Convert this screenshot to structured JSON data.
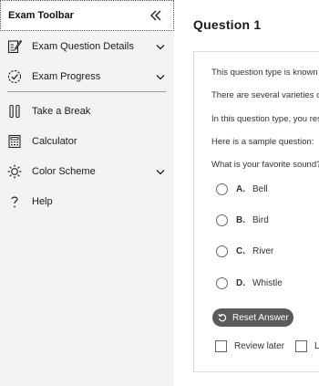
{
  "sidebar": {
    "title": "Exam Toolbar",
    "items": [
      {
        "label": "Exam Question Details",
        "icon": "edit-document-icon",
        "has_chevron": true
      },
      {
        "label": "Exam Progress",
        "icon": "checklist-icon",
        "has_chevron": true
      },
      {
        "label": "Take a Break",
        "icon": "pause-icon",
        "has_chevron": false
      },
      {
        "label": "Calculator",
        "icon": "calculator-icon",
        "has_chevron": false
      },
      {
        "label": "Color Scheme",
        "icon": "sun-icon",
        "has_chevron": true
      },
      {
        "label": "Help",
        "icon": "question-icon",
        "has_chevron": false
      }
    ]
  },
  "main": {
    "question_title": "Question 1",
    "paragraphs": [
      "This question type is known as",
      "There are several varieties of",
      "In this question type, you res",
      "Here is a sample question:",
      "What is your favorite sound?"
    ],
    "options": [
      {
        "letter": "A.",
        "text": "Bell"
      },
      {
        "letter": "B.",
        "text": "Bird"
      },
      {
        "letter": "C.",
        "text": "River"
      },
      {
        "letter": "D.",
        "text": "Whistle"
      }
    ],
    "reset_label": "Reset Answer",
    "review_label": "Review later",
    "second_checkbox_label": "L"
  },
  "colors": {
    "sidebar_bg": "#f3f3f3",
    "reset_button_bg": "#5a5a5a",
    "text": "#1a1a1a"
  }
}
